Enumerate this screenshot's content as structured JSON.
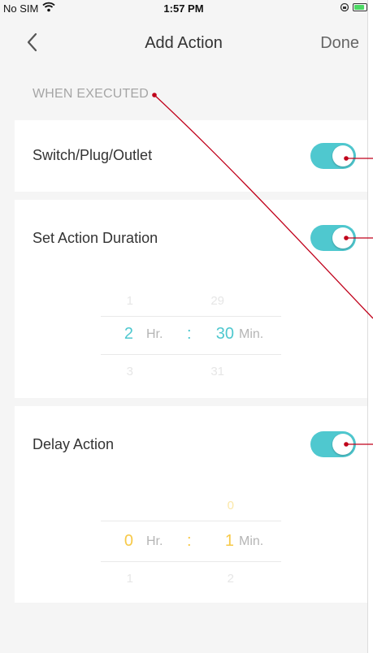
{
  "status_bar": {
    "carrier": "No SIM",
    "time": "1:57 PM"
  },
  "nav": {
    "title": "Add Action",
    "done_label": "Done"
  },
  "section_label": "WHEN EXECUTED",
  "cards": {
    "switch": {
      "label": "Switch/Plug/Outlet",
      "toggle_on": true
    },
    "duration": {
      "label": "Set Action Duration",
      "toggle_on": true,
      "picker": {
        "hr_prev": "1",
        "hr": "2",
        "hr_next": "3",
        "hr_unit": "Hr.",
        "separator": ":",
        "min_prev": "29",
        "min": "30",
        "min_next": "31",
        "min_unit": "Min."
      }
    },
    "delay": {
      "label": "Delay Action",
      "toggle_on": true,
      "picker": {
        "hr_prev": "",
        "hr": "0",
        "hr_next": "1",
        "hr_unit": "Hr.",
        "separator": ":",
        "min_prev": "0",
        "min": "1",
        "min_next": "2",
        "min_unit": "Min."
      }
    }
  },
  "colors": {
    "accent": "#4fc8cf",
    "delay_accent": "#f7c948",
    "annotation": "#c0001a"
  }
}
